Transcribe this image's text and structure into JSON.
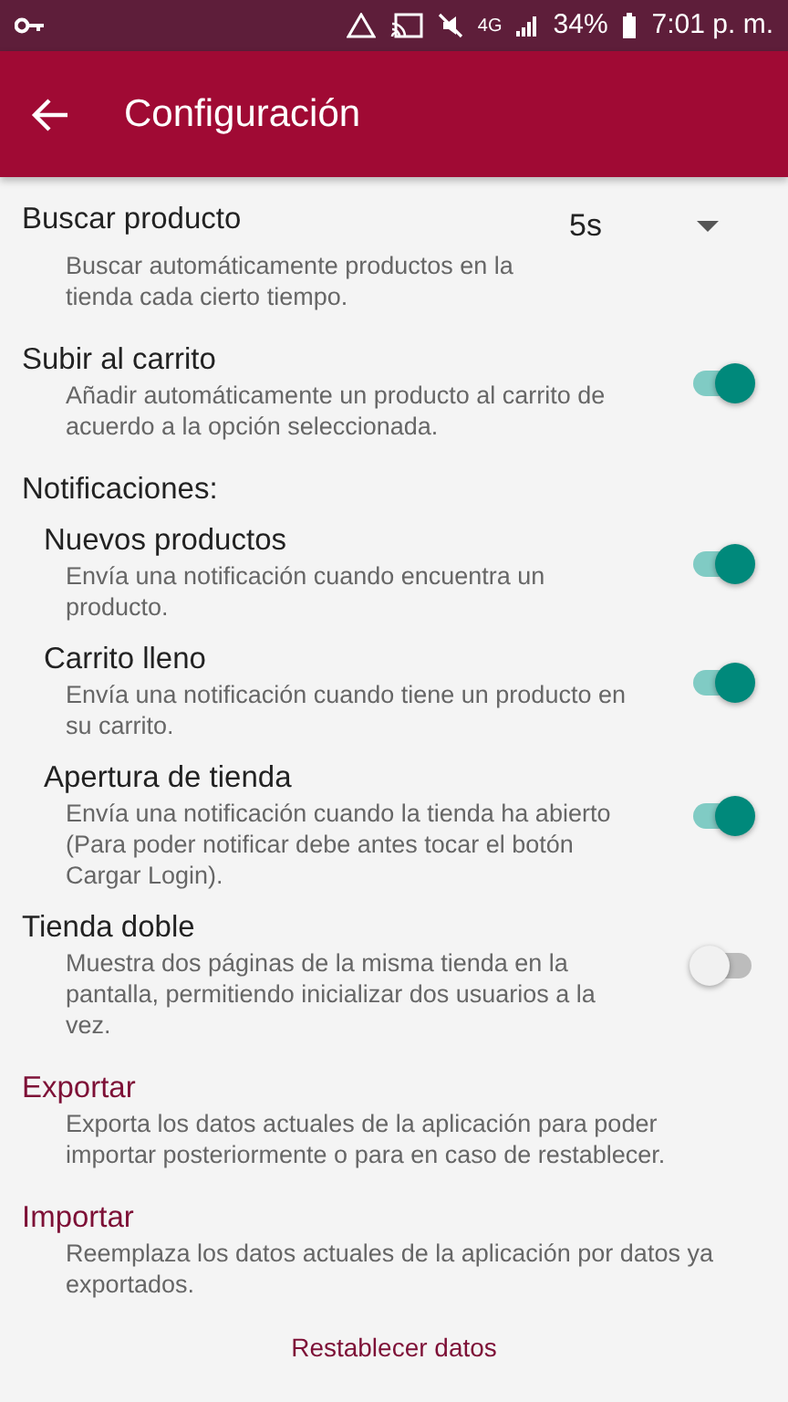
{
  "status_bar": {
    "network": "4G",
    "battery": "34%",
    "time": "7:01 p. m."
  },
  "app_bar": {
    "title": "Configuración"
  },
  "settings": [
    {
      "kind": "dropdown",
      "title": "Buscar producto",
      "description": "Buscar automáticamente productos en la tienda cada cierto tiempo.",
      "value": "5s"
    },
    {
      "kind": "switch",
      "title": "Subir al carrito",
      "description": "Añadir automáticamente un producto al carrito de acuerdo a la opción seleccionada.",
      "on": true
    },
    {
      "kind": "heading",
      "title": "Notificaciones:",
      "children": [
        {
          "kind": "switch",
          "title": "Nuevos productos",
          "description": "Envía una notificación cuando encuentra un producto.",
          "on": true
        },
        {
          "kind": "switch",
          "title": "Carrito lleno",
          "description": "Envía una notificación cuando tiene un producto en su carrito.",
          "on": true
        },
        {
          "kind": "switch",
          "title": "Apertura de tienda",
          "description": "Envía una notificación cuando la tienda ha abierto (Para poder notificar debe antes tocar el botón Cargar Login).",
          "on": true
        }
      ]
    },
    {
      "kind": "switch",
      "title": "Tienda doble",
      "description": "Muestra dos páginas de la misma tienda en la pantalla, permitiendo inicializar dos usuarios a la vez.",
      "on": false
    },
    {
      "kind": "action",
      "title": "Exportar",
      "description": "Exporta los datos actuales de la aplicación para poder importar posteriormente o para en caso de restablecer."
    },
    {
      "kind": "action",
      "title": "Importar",
      "description": "Reemplaza los datos actuales de la aplicación por datos ya exportados."
    }
  ],
  "reset_button": "Restablecer datos"
}
